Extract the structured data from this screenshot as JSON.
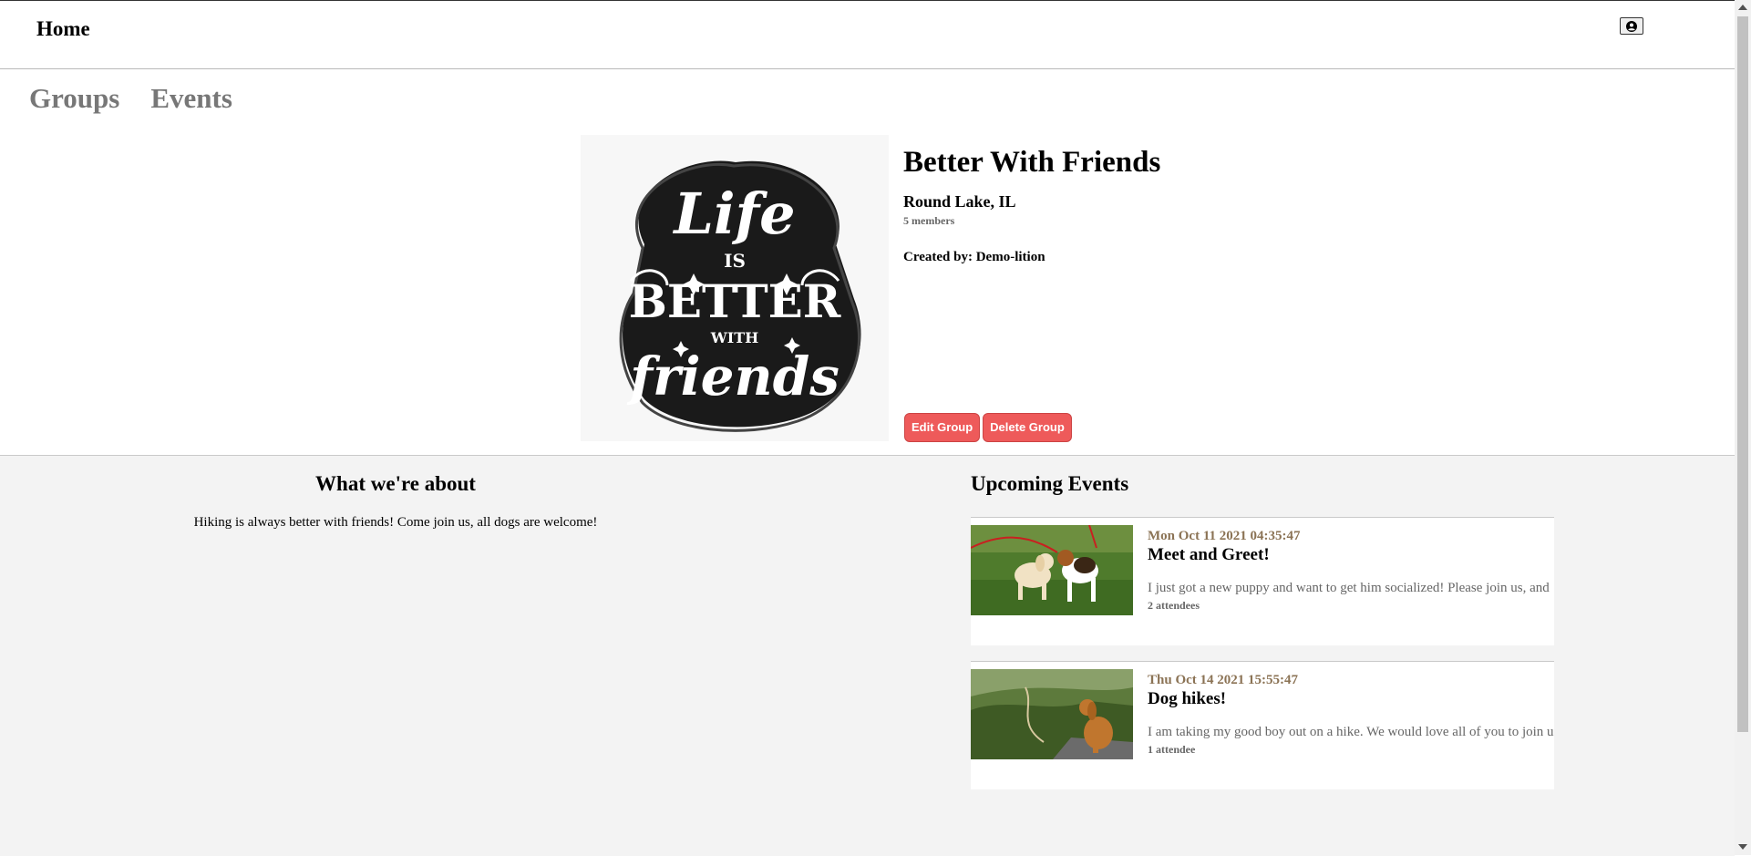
{
  "nav": {
    "home_label": "Home",
    "profile_icon": "user-circle-icon"
  },
  "tabs": [
    {
      "label": "Groups"
    },
    {
      "label": "Events"
    }
  ],
  "group": {
    "name": "Better With Friends",
    "location": "Round Lake, IL",
    "members": "5 members",
    "created_by": "Created by: Demo-lition",
    "image_text": [
      "Life",
      "IS",
      "BETTER",
      "WITH",
      "friends"
    ],
    "edit_label": "Edit Group",
    "delete_label": "Delete Group"
  },
  "about": {
    "title": "What we're about",
    "text": "Hiking is always better with friends! Come join us, all dogs are welcome!"
  },
  "events": {
    "title": "Upcoming Events",
    "items": [
      {
        "date": "Mon Oct 11 2021 04:35:47",
        "name": "Meet and Greet!",
        "description": "I just got a new puppy and want to get him socialized! Please join us, and bring your dogs!",
        "attendees": "2 attendees"
      },
      {
        "date": "Thu Oct 14 2021 15:55:47",
        "name": "Dog hikes!",
        "description": "I am taking my good boy out on a hike. We would love all of you to join us!",
        "attendees": "1 attendee"
      }
    ]
  },
  "colors": {
    "accent_button": "#ee5a5a",
    "date_text": "#8b7355",
    "bottom_bg": "#f3f3f3"
  }
}
